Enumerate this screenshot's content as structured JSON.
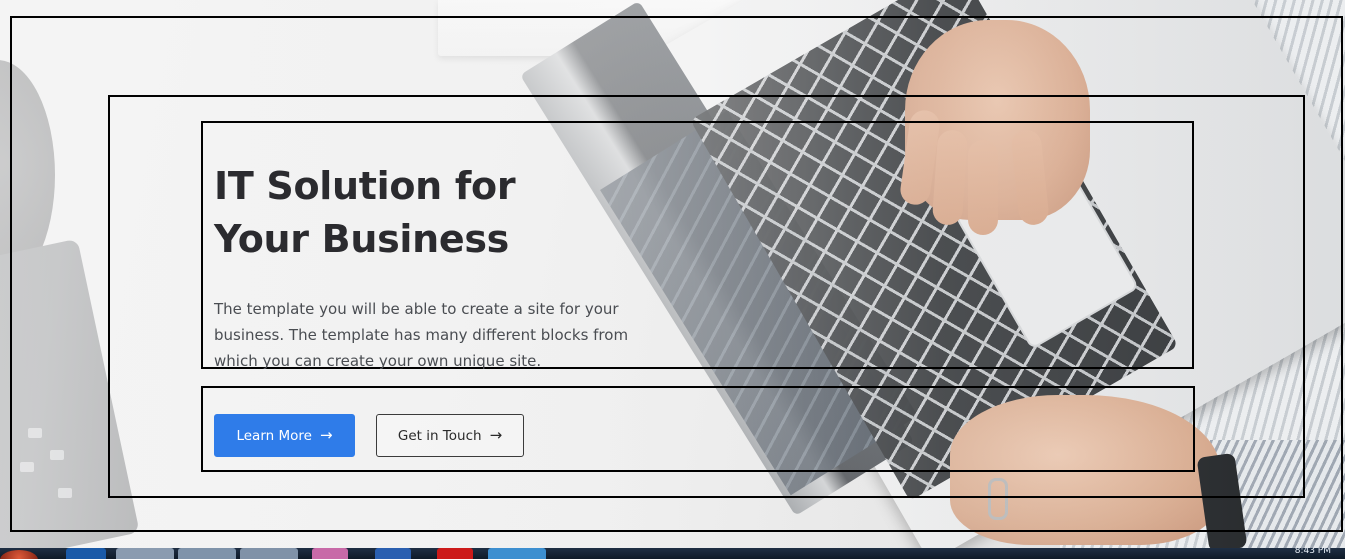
{
  "hero": {
    "title_line1": "IT Solution for",
    "title_line2": "Your Business",
    "description": "The template you will be able to create a site for your business. The template has many different blocks from which you can create your own unique site."
  },
  "buttons": {
    "primary_label": "Learn More",
    "secondary_label": "Get in Touch",
    "arrow": "→"
  },
  "colors": {
    "primary": "#2f7ce9",
    "title": "#2b2b2f",
    "text": "#4a4d52"
  },
  "taskbar": {
    "clock": "8:43 PM",
    "icons": [
      "start-orb-icon",
      "ie-icon",
      "folder-icon",
      "explorer-icon",
      "chrome-icon",
      "app-icon",
      "word-icon",
      "opera-icon",
      "vscode-icon"
    ]
  }
}
